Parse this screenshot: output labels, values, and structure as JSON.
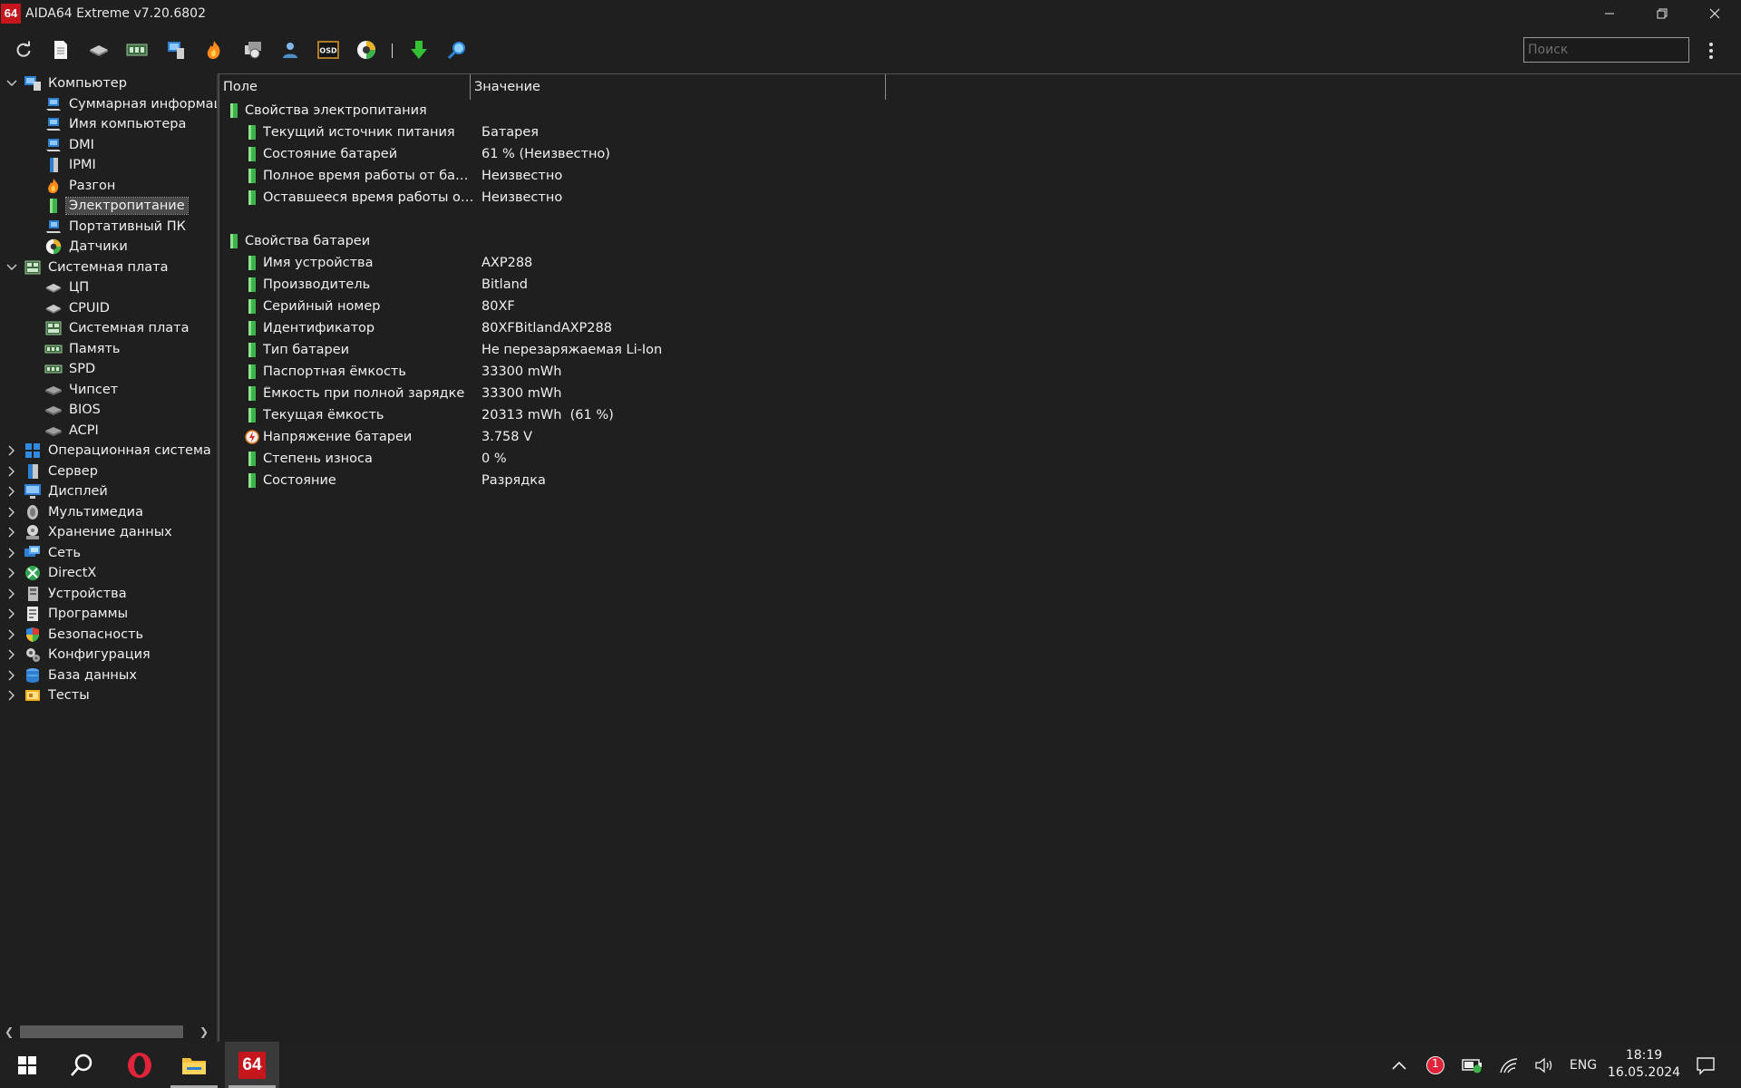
{
  "app": {
    "logo_text": "64",
    "title": "AIDA64 Extreme v7.20.6802"
  },
  "toolbar": {
    "icons": [
      "refresh-icon",
      "report-icon",
      "cpu-icon",
      "motherboard-icon",
      "computer-icon",
      "overclock-icon",
      "network-icon",
      "user-icon",
      "osd-icon",
      "sensor-icon",
      "download-icon",
      "search-tool-icon"
    ],
    "osd_label": "OSD",
    "search_placeholder": "Поиск"
  },
  "tree": {
    "items": [
      {
        "label": "Компьютер",
        "icon": "computer-icon",
        "level": 0,
        "expander": "open"
      },
      {
        "label": "Суммарная информац",
        "icon": "computer-small-icon",
        "level": 1
      },
      {
        "label": "Имя компьютера",
        "icon": "computer-small-icon",
        "level": 1
      },
      {
        "label": "DMI",
        "icon": "computer-small-icon",
        "level": 1
      },
      {
        "label": "IPMI",
        "icon": "server-small-icon",
        "level": 1
      },
      {
        "label": "Разгон",
        "icon": "flame-icon",
        "level": 1
      },
      {
        "label": "Электропитание",
        "icon": "battery-icon",
        "level": 1,
        "selected": true
      },
      {
        "label": "Портативный ПК",
        "icon": "laptop-icon",
        "level": 1
      },
      {
        "label": "Датчики",
        "icon": "gauge-icon",
        "level": 1
      },
      {
        "label": "Системная плата",
        "icon": "motherboard-icon",
        "level": 0,
        "expander": "open"
      },
      {
        "label": "ЦП",
        "icon": "cpu-icon",
        "level": 1
      },
      {
        "label": "CPUID",
        "icon": "cpu-icon",
        "level": 1
      },
      {
        "label": "Системная плата",
        "icon": "motherboard-icon",
        "level": 1
      },
      {
        "label": "Память",
        "icon": "ram-icon",
        "level": 1
      },
      {
        "label": "SPD",
        "icon": "ram-icon",
        "level": 1
      },
      {
        "label": "Чипсет",
        "icon": "chip-icon",
        "level": 1
      },
      {
        "label": "BIOS",
        "icon": "chip-icon",
        "level": 1
      },
      {
        "label": "ACPI",
        "icon": "chip-icon",
        "level": 1
      },
      {
        "label": "Операционная система",
        "icon": "windows-icon",
        "level": 0,
        "expander": "closed"
      },
      {
        "label": "Сервер",
        "icon": "server-icon",
        "level": 0,
        "expander": "closed"
      },
      {
        "label": "Дисплей",
        "icon": "display-icon",
        "level": 0,
        "expander": "closed"
      },
      {
        "label": "Мультимедиа",
        "icon": "multimedia-icon",
        "level": 0,
        "expander": "closed"
      },
      {
        "label": "Хранение данных",
        "icon": "storage-icon",
        "level": 0,
        "expander": "closed"
      },
      {
        "label": "Сеть",
        "icon": "network-icon",
        "level": 0,
        "expander": "closed"
      },
      {
        "label": "DirectX",
        "icon": "xbox-icon",
        "level": 0,
        "expander": "closed"
      },
      {
        "label": "Устройства",
        "icon": "devices-icon",
        "level": 0,
        "expander": "closed"
      },
      {
        "label": "Программы",
        "icon": "programs-icon",
        "level": 0,
        "expander": "closed"
      },
      {
        "label": "Безопасность",
        "icon": "shield-icon",
        "level": 0,
        "expander": "closed"
      },
      {
        "label": "Конфигурация",
        "icon": "config-icon",
        "level": 0,
        "expander": "closed"
      },
      {
        "label": "База данных",
        "icon": "database-icon",
        "level": 0,
        "expander": "closed"
      },
      {
        "label": "Тесты",
        "icon": "benchmark-icon",
        "level": 0,
        "expander": "closed"
      }
    ]
  },
  "list": {
    "columns": [
      "Поле",
      "Значение"
    ],
    "rows": [
      {
        "type": "group",
        "field": "Свойства электропитания",
        "icon": "battery-icon"
      },
      {
        "type": "item",
        "field": "Текущий источник питания",
        "value": "Батарея",
        "icon": "battery-icon"
      },
      {
        "type": "item",
        "field": "Состояние батарей",
        "value": "61 % (Неизвестно)",
        "icon": "battery-icon"
      },
      {
        "type": "item",
        "field": "Полное время работы от бата...",
        "value": "Неизвестно",
        "icon": "battery-icon"
      },
      {
        "type": "item",
        "field": "Оставшееся время работы от ...",
        "value": "Неизвестно",
        "icon": "battery-icon"
      },
      {
        "type": "blank"
      },
      {
        "type": "group",
        "field": "Свойства батареи",
        "icon": "battery-icon"
      },
      {
        "type": "item",
        "field": "Имя устройства",
        "value": "AXP288",
        "icon": "battery-icon"
      },
      {
        "type": "item",
        "field": "Производитель",
        "value": "Bitland",
        "icon": "battery-icon"
      },
      {
        "type": "item",
        "field": "Серийный номер",
        "value": "80XF",
        "icon": "battery-icon"
      },
      {
        "type": "item",
        "field": "Идентификатор",
        "value": "80XFBitlandAXP288",
        "icon": "battery-icon"
      },
      {
        "type": "item",
        "field": "Тип батареи",
        "value": "Не перезаряжаемая Li-Ion",
        "icon": "battery-icon"
      },
      {
        "type": "item",
        "field": "Паспортная ёмкость",
        "value": "33300 mWh",
        "icon": "battery-icon"
      },
      {
        "type": "item",
        "field": "Ёмкость при полной зарядке",
        "value": "33300 mWh",
        "icon": "battery-icon"
      },
      {
        "type": "item",
        "field": "Текущая ёмкость",
        "value": "20313 mWh  (61 %)",
        "icon": "battery-icon"
      },
      {
        "type": "item",
        "field": "Напряжение батареи",
        "value": "3.758 V",
        "icon": "voltage-icon"
      },
      {
        "type": "item",
        "field": "Степень износа",
        "value": "0 %",
        "icon": "battery-icon"
      },
      {
        "type": "item",
        "field": "Состояние",
        "value": "Разрядка",
        "icon": "battery-icon"
      }
    ]
  },
  "taskbar": {
    "apps": [
      "start-icon",
      "search-icon",
      "opera-icon",
      "file-explorer-icon",
      "aida64-icon"
    ],
    "aida_label": "64",
    "notification_count": "1",
    "language": "ENG",
    "time": "18:19",
    "date": "16.05.2024"
  },
  "colors": {
    "background": "#1f1f1f",
    "battery_green": "#3cb44a",
    "aida_red": "#c4161c",
    "selection": "#4a4a4a"
  }
}
